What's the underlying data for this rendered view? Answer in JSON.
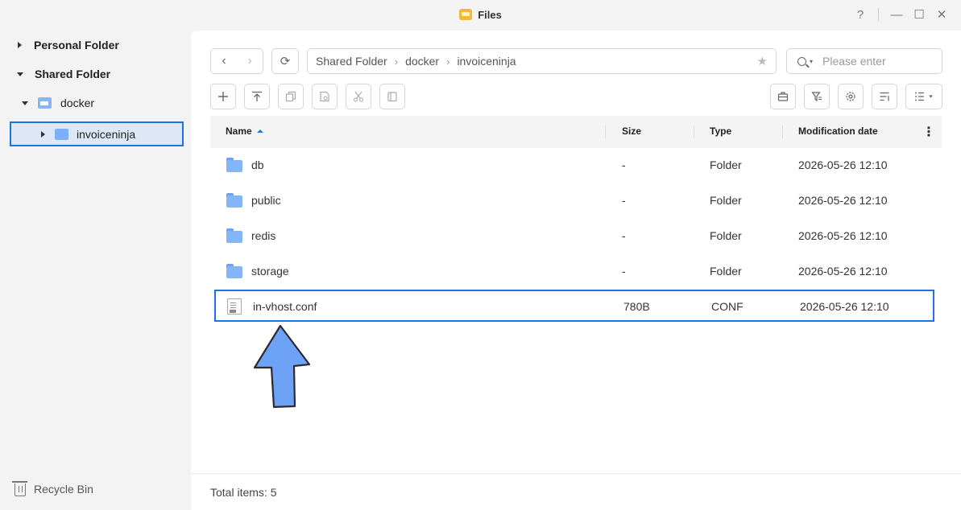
{
  "window": {
    "title": "Files",
    "controls": {
      "help": "?",
      "minimize": "—",
      "maximize": "☐",
      "close": "✕"
    }
  },
  "sidebar": {
    "personal_folder": "Personal Folder",
    "shared_folder": "Shared Folder",
    "docker": "docker",
    "invoiceninja": "invoiceninja",
    "recycle_bin": "Recycle Bin"
  },
  "toolbar": {
    "back": "‹",
    "forward": "›",
    "refresh": "⟳",
    "search_placeholder": "Please enter",
    "star": "★"
  },
  "breadcrumb": [
    "Shared Folder",
    "docker",
    "invoiceninja"
  ],
  "table": {
    "headers": {
      "name": "Name",
      "size": "Size",
      "type": "Type",
      "date": "Modification date"
    },
    "sort": {
      "column": "Name",
      "direction": "ascending"
    },
    "rows": [
      {
        "name": "db",
        "size": "-",
        "type": "Folder",
        "date": "2026-05-26 12:10",
        "kind": "folder"
      },
      {
        "name": "public",
        "size": "-",
        "type": "Folder",
        "date": "2026-05-26 12:10",
        "kind": "folder"
      },
      {
        "name": "redis",
        "size": "-",
        "type": "Folder",
        "date": "2026-05-26 12:10",
        "kind": "folder"
      },
      {
        "name": "storage",
        "size": "-",
        "type": "Folder",
        "date": "2026-05-26 12:10",
        "kind": "folder"
      },
      {
        "name": "in-vhost.conf",
        "size": "780B",
        "type": "CONF",
        "date": "2026-05-26 12:10",
        "kind": "file"
      }
    ]
  },
  "footer": {
    "total": "Total items: 5"
  },
  "colors": {
    "accent": "#1a73e8",
    "folder": "#84b5fa",
    "arrow": "#6ea2f7"
  }
}
